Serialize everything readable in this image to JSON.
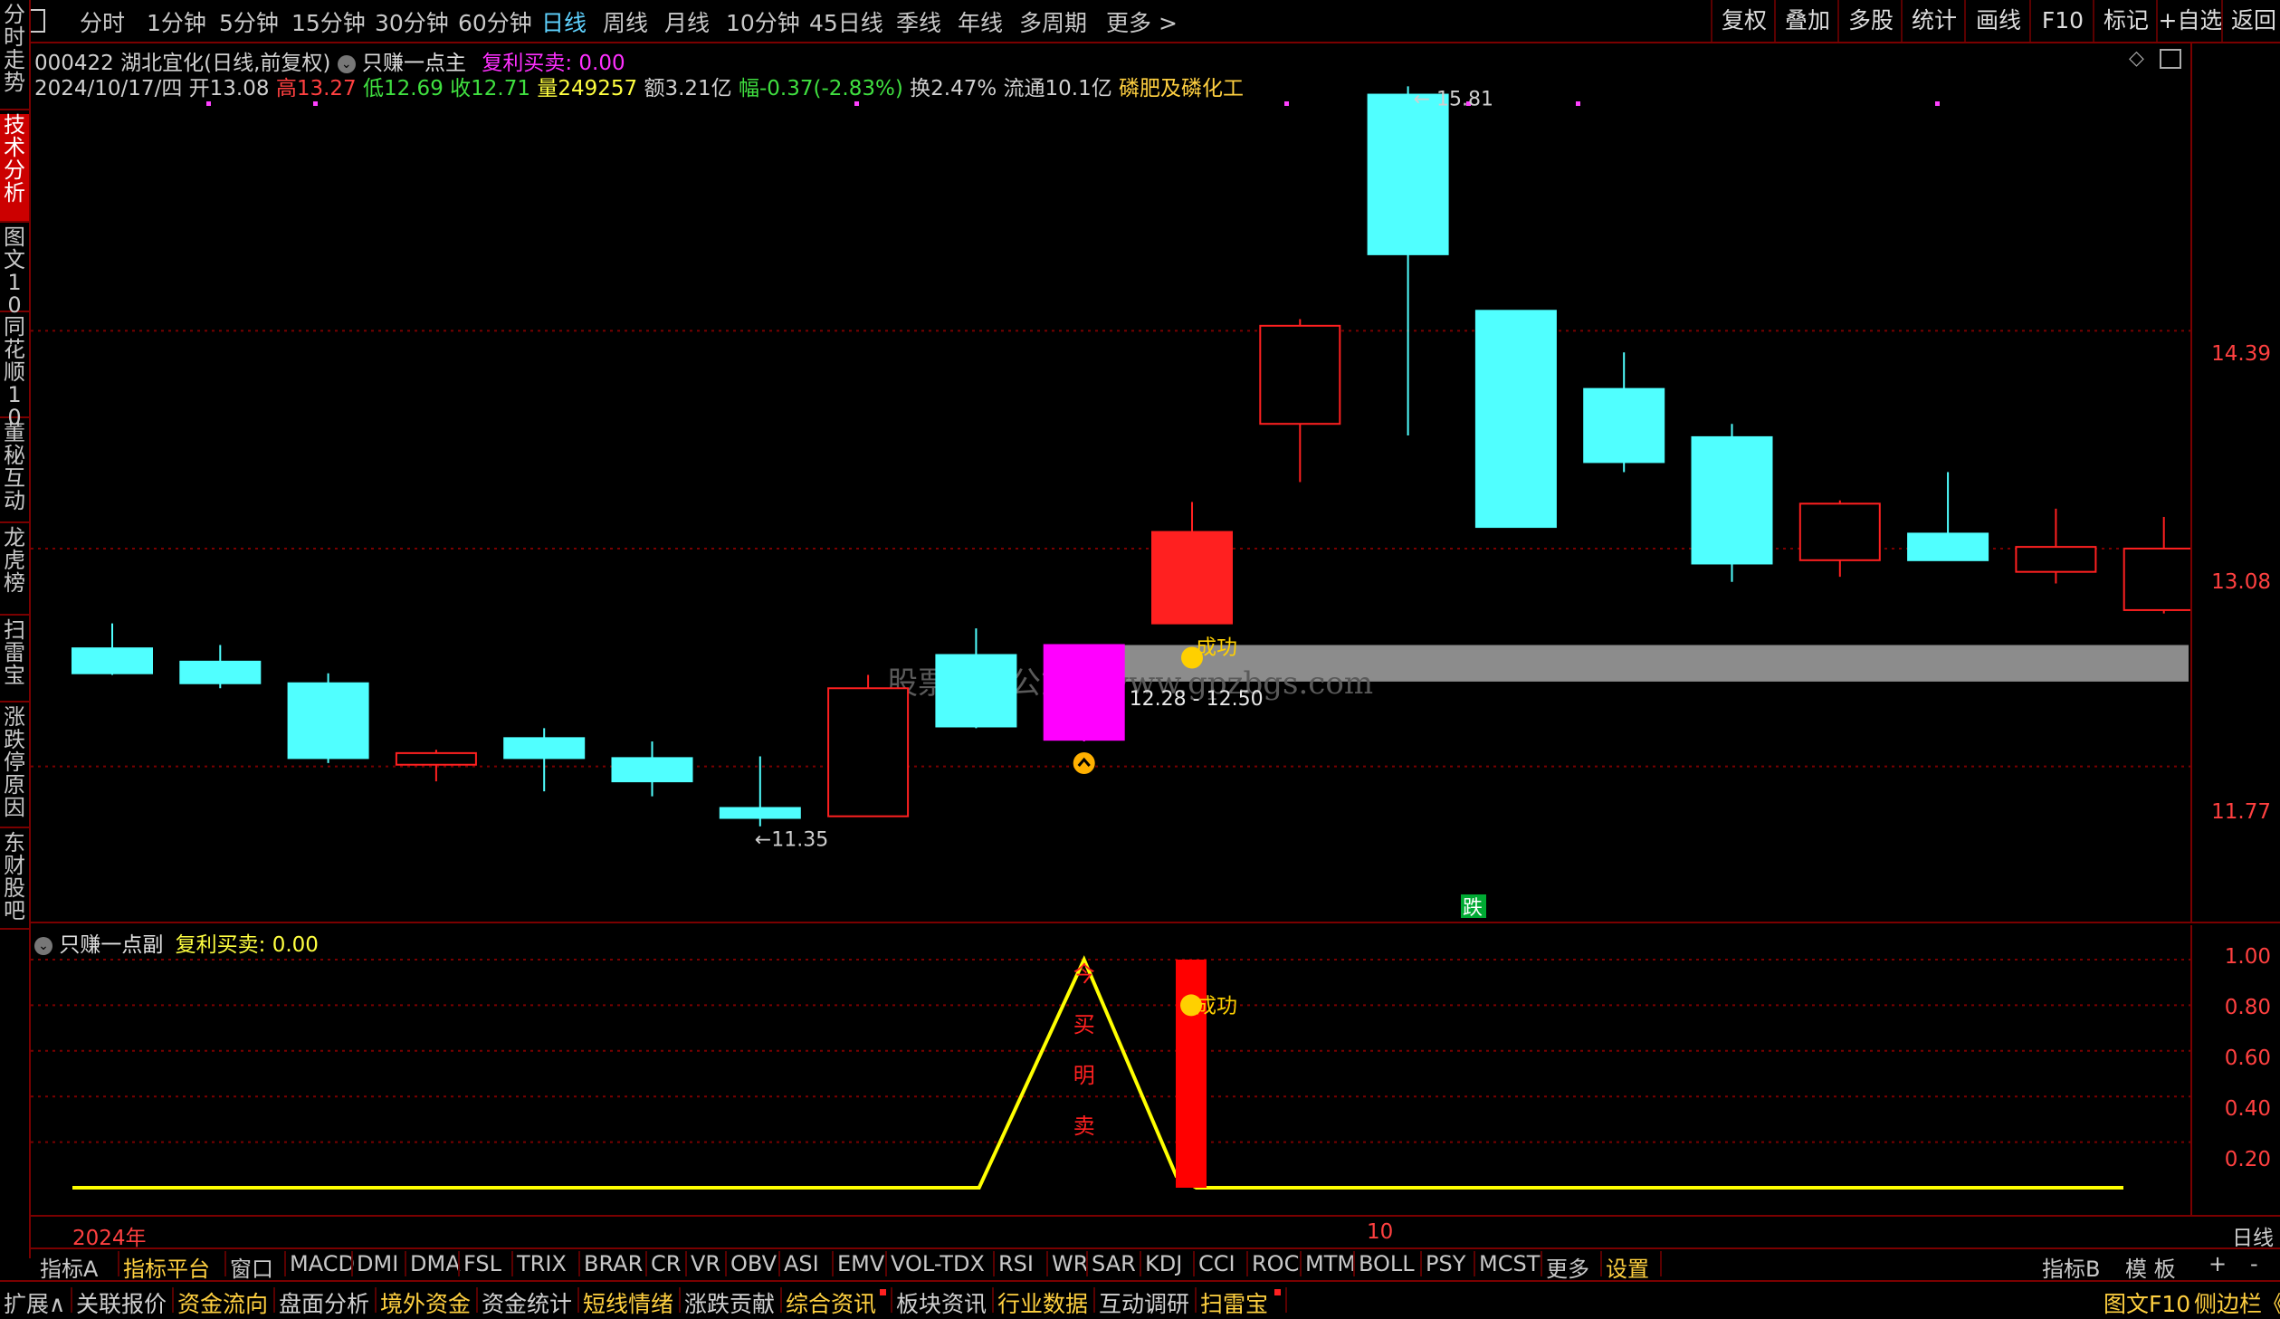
{
  "toolbar": {
    "periods": [
      "分时",
      "1分钟",
      "5分钟",
      "15分钟",
      "30分钟",
      "60分钟",
      "日线",
      "周线",
      "月线",
      "10分钟",
      "45日线",
      "季线",
      "年线",
      "多周期",
      "更多 >"
    ],
    "active_period": "日线",
    "right_buttons": [
      "复权",
      "叠加",
      "多股",
      "统计",
      "画线",
      "F10",
      "标记",
      "+自选",
      "返回"
    ]
  },
  "left_rail": [
    "分时走势",
    "技术分析",
    "图文10",
    "同花顺10",
    "董秘互动",
    "龙虎榜",
    "扫雷宝",
    "涨跌停原因",
    "东财股吧"
  ],
  "stock": {
    "code": "000422",
    "name": "湖北宜化",
    "mode": "(日线,前复权)",
    "indicator": "只赚一点主",
    "signal_label": "复利买卖:",
    "signal_value": "0.00",
    "date": "2024/10/17/四",
    "open": "开13.08",
    "high": "高13.27",
    "low": "低12.69",
    "close": "收12.71",
    "volume": "量249257",
    "amount": "额3.21亿",
    "change": "幅-0.37(-2.83%)",
    "turnover": "换2.47%",
    "float_cap": "流通10.1亿",
    "sector": "磷肥及磷化工"
  },
  "main_axis": [
    "14.39",
    "13.08",
    "11.77"
  ],
  "annotations": {
    "high_marker": "15.81",
    "low_marker": "11.35",
    "zone": "12.28 - 12.50",
    "success": "成功",
    "fall": "跌",
    "watermark": "股票指标公式网www.gpzbgs.com"
  },
  "sub_panel": {
    "indicator": "只赚一点副",
    "signal_label": "复利买卖:",
    "signal_value": "0.00",
    "axis": [
      "1.00",
      "0.80",
      "0.60",
      "0.40",
      "0.20"
    ],
    "vertical_text": [
      "今",
      "买",
      "明",
      "卖"
    ],
    "success": "成功"
  },
  "date_axis": {
    "year": "2024年",
    "month": "10",
    "period": "日线"
  },
  "indicator_tabs": [
    "指标A",
    "指标平台",
    "窗口",
    "MACD",
    "DMI",
    "DMA",
    "FSL",
    "TRIX",
    "BRAR",
    "CR",
    "VR",
    "OBV",
    "ASI",
    "EMV",
    "VOL-TDX",
    "RSI",
    "WR",
    "SAR",
    "KDJ",
    "CCI",
    "ROC",
    "MTM",
    "BOLL",
    "PSY",
    "MCST",
    "更多",
    "设置"
  ],
  "indicator_right": [
    "指标B",
    "模 板",
    "+",
    "-"
  ],
  "status_bar": [
    "扩展∧",
    "关联报价",
    "资金流向",
    "盘面分析",
    "境外资金",
    "资金统计",
    "短线情绪",
    "涨跌贡献",
    "综合资讯",
    "板块资讯",
    "行业数据",
    "互动调研",
    "扫雷宝"
  ],
  "status_right": [
    "图文F10",
    "侧边栏《"
  ],
  "colors": {
    "up": "#ff2020",
    "down": "#50ffff",
    "buy": "#ff00ff",
    "signal": "#ffff00",
    "grid": "#7a0000"
  },
  "chart_data": {
    "type": "candlestick",
    "title": "湖北宜化(日线,前复权)",
    "ylim": [
      11.0,
      15.9
    ],
    "candles": [
      {
        "o": 12.48,
        "h": 12.63,
        "l": 12.32,
        "c": 12.33
      },
      {
        "o": 12.4,
        "h": 12.5,
        "l": 12.24,
        "c": 12.27
      },
      {
        "o": 12.27,
        "h": 12.33,
        "l": 11.79,
        "c": 11.82
      },
      {
        "o": 11.78,
        "h": 11.87,
        "l": 11.68,
        "c": 11.85
      },
      {
        "o": 11.94,
        "h": 12.0,
        "l": 11.62,
        "c": 11.82
      },
      {
        "o": 11.82,
        "h": 11.92,
        "l": 11.59,
        "c": 11.68
      },
      {
        "o": 11.52,
        "h": 11.83,
        "l": 11.41,
        "c": 11.46
      },
      {
        "o": 11.47,
        "h": 12.32,
        "l": 11.47,
        "c": 12.24
      },
      {
        "o": 12.44,
        "h": 12.6,
        "l": 12.0,
        "c": 12.01
      },
      {
        "o": 12.5,
        "h": 12.5,
        "l": 11.92,
        "c": 11.93
      },
      {
        "o": 12.63,
        "h": 13.36,
        "l": 12.63,
        "c": 13.18
      },
      {
        "o": 13.83,
        "h": 14.46,
        "l": 13.48,
        "c": 14.42
      },
      {
        "o": 15.81,
        "h": 15.86,
        "l": 13.76,
        "c": 14.85
      },
      {
        "o": 14.51,
        "h": 14.51,
        "l": 13.21,
        "c": 13.21
      },
      {
        "o": 14.04,
        "h": 14.26,
        "l": 13.54,
        "c": 13.6
      },
      {
        "o": 13.75,
        "h": 13.83,
        "l": 12.88,
        "c": 12.99
      },
      {
        "o": 13.01,
        "h": 13.37,
        "l": 12.91,
        "c": 13.35
      },
      {
        "o": 13.17,
        "h": 13.54,
        "l": 13.04,
        "c": 13.01
      },
      {
        "o": 12.94,
        "h": 13.32,
        "l": 12.87,
        "c": 13.09
      },
      {
        "o": 12.71,
        "h": 13.27,
        "l": 12.69,
        "c": 13.08
      }
    ],
    "buy_candle_index": 9,
    "sub_series": {
      "name": "只赚一点副",
      "peak_index": 9,
      "peak_value": 1.0,
      "bar_index": 10,
      "bar_value": 1.0
    }
  }
}
